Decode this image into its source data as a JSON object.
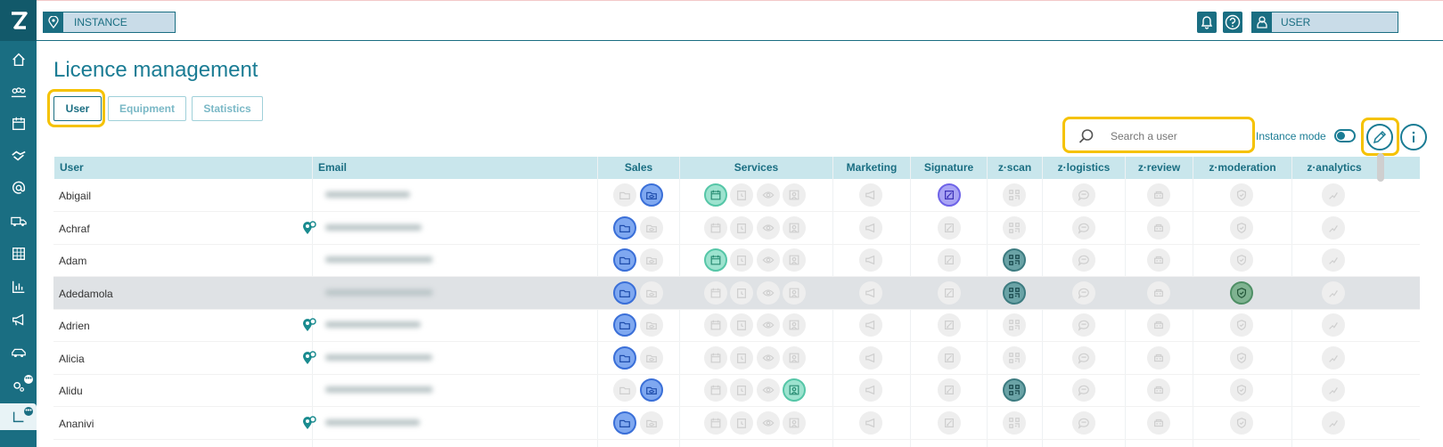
{
  "topbar": {
    "instance_label": "INSTANCE",
    "user_label": "USER"
  },
  "page": {
    "title": "Licence management"
  },
  "tabs": [
    {
      "label": "User",
      "active": true
    },
    {
      "label": "Equipment",
      "active": false
    },
    {
      "label": "Statistics",
      "active": false
    }
  ],
  "tools": {
    "search_placeholder": "Search a user",
    "instance_mode_label": "Instance mode",
    "instance_mode_on": false
  },
  "columns": [
    "User",
    "Email",
    "Sales",
    "Services",
    "Marketing",
    "Signature",
    "z·scan",
    "z·logistics",
    "z·review",
    "z·moderation",
    "z·analytics"
  ],
  "rows": [
    {
      "name": "Abigail",
      "pin": false,
      "selected": false,
      "sales": [
        "off",
        "blue"
      ],
      "services": [
        "teal",
        "off",
        "off",
        "off"
      ],
      "marketing": "off",
      "signature": "purple",
      "zscan": "off",
      "zlogistics": "off",
      "zreview": "off",
      "zmoderation": "off",
      "zanalytics": "off"
    },
    {
      "name": "Achraf",
      "pin": true,
      "selected": false,
      "sales": [
        "blue",
        "off"
      ],
      "services": [
        "off",
        "off",
        "off",
        "off"
      ],
      "marketing": "off",
      "signature": "off",
      "zscan": "off",
      "zlogistics": "off",
      "zreview": "off",
      "zmoderation": "off",
      "zanalytics": "off"
    },
    {
      "name": "Adam",
      "pin": false,
      "selected": false,
      "sales": [
        "blue",
        "off"
      ],
      "services": [
        "teal",
        "off",
        "off",
        "off"
      ],
      "marketing": "off",
      "signature": "off",
      "zscan": "qr",
      "zlogistics": "off",
      "zreview": "off",
      "zmoderation": "off",
      "zanalytics": "off"
    },
    {
      "name": "Adedamola",
      "pin": false,
      "selected": true,
      "sales": [
        "blue",
        "off"
      ],
      "services": [
        "off",
        "off",
        "off",
        "off"
      ],
      "marketing": "off",
      "signature": "off",
      "zscan": "qr",
      "zlogistics": "off",
      "zreview": "off",
      "zmoderation": "green",
      "zanalytics": "off"
    },
    {
      "name": "Adrien",
      "pin": true,
      "selected": false,
      "sales": [
        "blue",
        "off"
      ],
      "services": [
        "off",
        "off",
        "off",
        "off"
      ],
      "marketing": "off",
      "signature": "off",
      "zscan": "off",
      "zlogistics": "off",
      "zreview": "off",
      "zmoderation": "off",
      "zanalytics": "off"
    },
    {
      "name": "Alicia",
      "pin": true,
      "selected": false,
      "sales": [
        "blue",
        "off"
      ],
      "services": [
        "off",
        "off",
        "off",
        "off"
      ],
      "marketing": "off",
      "signature": "off",
      "zscan": "off",
      "zlogistics": "off",
      "zreview": "off",
      "zmoderation": "off",
      "zanalytics": "off"
    },
    {
      "name": "Alidu",
      "pin": false,
      "selected": false,
      "sales": [
        "off",
        "blue"
      ],
      "services": [
        "off",
        "off",
        "off",
        "teal"
      ],
      "marketing": "off",
      "signature": "off",
      "zscan": "qr",
      "zlogistics": "off",
      "zreview": "off",
      "zmoderation": "off",
      "zanalytics": "off"
    },
    {
      "name": "Ananivi",
      "pin": true,
      "selected": false,
      "sales": [
        "blue",
        "off"
      ],
      "services": [
        "off",
        "off",
        "off",
        "off"
      ],
      "marketing": "off",
      "signature": "off",
      "zscan": "off",
      "zlogistics": "off",
      "zreview": "off",
      "zmoderation": "off",
      "zanalytics": "off"
    }
  ],
  "sidebar": {
    "items": [
      "home-icon",
      "group-icon",
      "calendar-icon",
      "handshake-icon",
      "at-icon",
      "truck-icon",
      "table-icon",
      "bar-chart-icon",
      "megaphone-icon",
      "car-icon",
      "settings-icon",
      "chart-corner-icon"
    ]
  },
  "colors": {
    "brand": "#1a6e82",
    "title": "#1a7c94",
    "highlight": "#f5c200",
    "header_bg": "#c9e6ec"
  }
}
